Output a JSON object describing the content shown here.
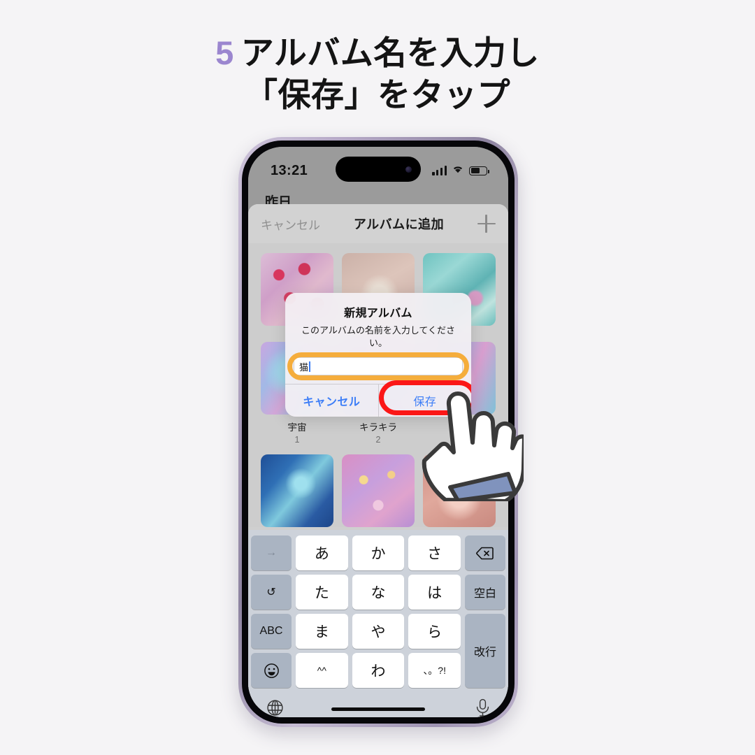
{
  "heading": {
    "step_number": "5",
    "line1": "アルバム名を入力し",
    "line2": "「保存」をタップ",
    "accent_color": "#9b86cf"
  },
  "phone": {
    "status_bar": {
      "time": "13:21",
      "signal_icon": "cellular-bars-icon",
      "wifi_icon": "wifi-icon",
      "battery_icon": "battery-icon"
    },
    "background_label": "昨日"
  },
  "sheet": {
    "nav": {
      "cancel_label": "キャンセル",
      "title": "アルバムに追加",
      "add_icon": "plus-icon"
    },
    "albums": [
      {
        "name": "",
        "count": "",
        "art": "t-straw"
      },
      {
        "name": "",
        "count": "",
        "art": "t-beige"
      },
      {
        "name": "",
        "count": "",
        "art": "t-butter"
      },
      {
        "name": "宇宙",
        "count": "1",
        "art": "t-iris1"
      },
      {
        "name": "キラキラ",
        "count": "2",
        "art": "t-iris2"
      },
      {
        "name": "",
        "count": "",
        "art": "t-iris3"
      },
      {
        "name": "",
        "count": "",
        "art": "t-galaxy"
      },
      {
        "name": "",
        "count": "",
        "art": "t-bokeh"
      },
      {
        "name": "",
        "count": "",
        "art": "t-flower"
      }
    ]
  },
  "alert": {
    "title": "新規アルバム",
    "message": "このアルバムの名前を入力してください。",
    "input_value": "猫",
    "cancel_label": "キャンセル",
    "save_label": "保存",
    "highlight_input_color": "#f5ad3c",
    "highlight_save_color": "#fb1717"
  },
  "keyboard": {
    "keys": {
      "next": "→",
      "undo": "↺",
      "abc": "ABC",
      "emoji": "emoji-icon",
      "a": "あ",
      "ka": "か",
      "sa": "さ",
      "ta": "た",
      "na": "な",
      "ha": "は",
      "ma": "ま",
      "ya": "や",
      "ra": "ら",
      "kaomoji": "^^",
      "wa": "わ",
      "punct": "、。?!",
      "delete": "delete-icon",
      "space": "空白",
      "enter": "改行"
    },
    "globe_icon": "globe-icon",
    "mic_icon": "microphone-icon"
  },
  "cursor": {
    "icon": "pointing-hand-cursor"
  }
}
